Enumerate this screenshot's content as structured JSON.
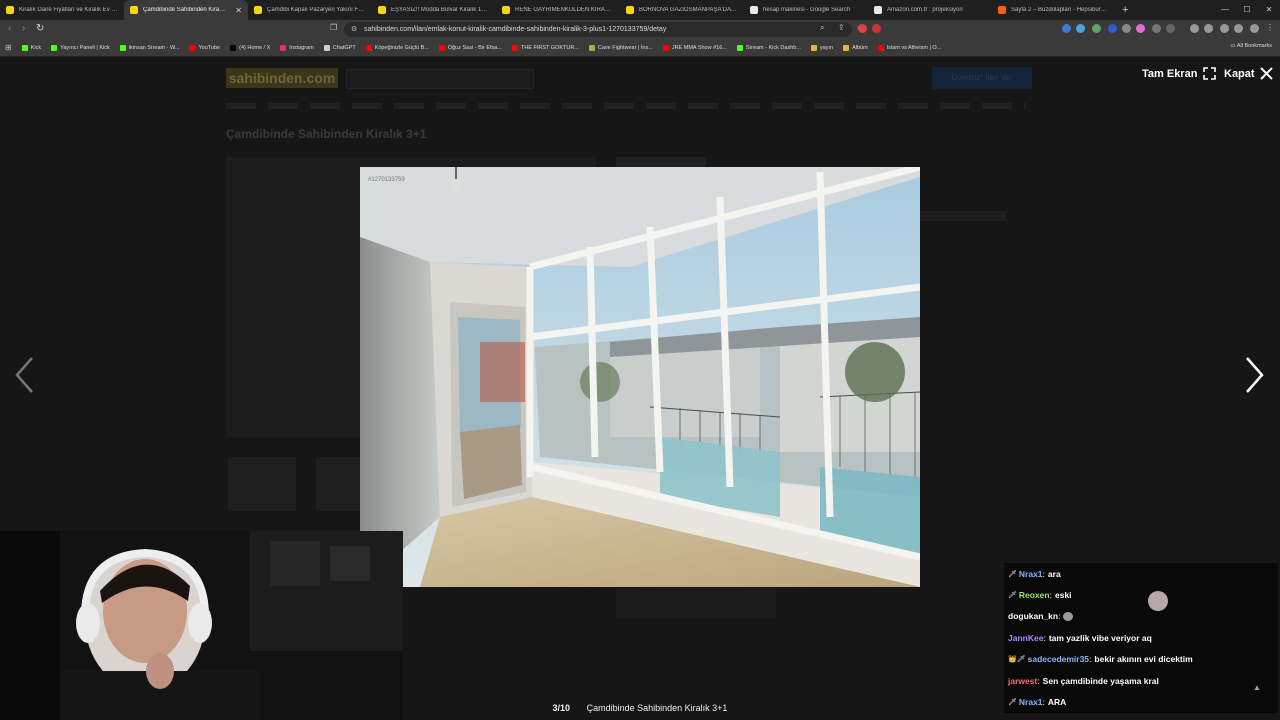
{
  "browser": {
    "tabs": [
      {
        "title": "Kiralık Daire Fiyatları ve Kiralık Ev İlanları",
        "color": "#f5d800",
        "icon": "sahibinden-favicon",
        "active": false
      },
      {
        "title": "Çamdibinde Sahibinden Kiralık 3+1",
        "color": "#f5d800",
        "icon": "sahibinden-favicon",
        "active": true
      },
      {
        "title": "Çamdibi Kapalı Pazaryeri Yakını Full E",
        "color": "#f5d800",
        "icon": "sahibinden-favicon",
        "active": false
      },
      {
        "title": "EŞYASIZ!! Modda Bulvar Kiralık 1+1 Da",
        "color": "#f5d800",
        "icon": "sahibinden-favicon",
        "active": false
      },
      {
        "title": "RENE GAYRİMENKULDEN KİRALIK 2+1",
        "color": "#f5d800",
        "icon": "sahibinden-favicon",
        "active": false
      },
      {
        "title": "BORNOVA GAZİOSMANPAŞA'DA KAPAL",
        "color": "#f5d800",
        "icon": "sahibinden-favicon",
        "active": false
      },
      {
        "title": "hesap makinesi - Google Search",
        "color": "#e8e8e8",
        "icon": "google-favicon",
        "active": false
      },
      {
        "title": "Amazon.com.tr : projeksiyon",
        "color": "#e8e8e8",
        "icon": "amazon-favicon",
        "active": false
      },
      {
        "title": "Sayfa 2 – Buzdolapları - Hepsiburada",
        "color": "#ff6000",
        "icon": "hepsiburada-favicon",
        "active": false
      }
    ],
    "tab_close": "✕",
    "new_tab": "+",
    "url": "sahibinden.com/ilan/emlak-konut-kiralik-camdibinde-sahibinden-kiralik-3-plus1-1270133759/detay",
    "bookmarks": [
      {
        "label": "Kick",
        "color": "#53fc18"
      },
      {
        "label": "Yayıncı Paneli | Kick",
        "color": "#53fc18"
      },
      {
        "label": "ikinsan Stream - W...",
        "color": "#53fc18"
      },
      {
        "label": "YouTube",
        "color": "#ff0000"
      },
      {
        "label": "(4) Home / X",
        "color": "#000000"
      },
      {
        "label": "Instagram",
        "color": "#e1306c"
      },
      {
        "label": "ChatGPT",
        "color": "#cccccc"
      },
      {
        "label": "Köpeğinizle Güçlü B...",
        "color": "#ff0000"
      },
      {
        "label": "Oğuz Sasi - Bir Efsa...",
        "color": "#ff0000"
      },
      {
        "label": "THE FIRST GOKTUR...",
        "color": "#ff0000"
      },
      {
        "label": "Cave Fightwear | İns...",
        "color": "#86c040"
      },
      {
        "label": "JRE MMA Show #16...",
        "color": "#ff0000"
      },
      {
        "label": "Stream - Kick Dashb...",
        "color": "#53fc18"
      },
      {
        "label": "yayın",
        "color": "#e0b040"
      },
      {
        "label": "Albüm",
        "color": "#e0b040"
      },
      {
        "label": "Islam vs Atheism | O...",
        "color": "#ff0000"
      }
    ],
    "all_bookmarks": "All Bookmarks"
  },
  "page": {
    "logo": "sahibinden.com",
    "cta": "Ücretsiz* İlan Ver",
    "title": "Çamdibinde Sahibinden Kiralık 3+1"
  },
  "viewer": {
    "fullscreen_label": "Tam Ekran",
    "close_label": "Kapat",
    "counter": "3/10",
    "caption": "Çamdibinde Sahibinden Kiralık 3+1",
    "photo_watermark": "#1270133759"
  },
  "chat": {
    "messages": [
      {
        "badge": "🗡",
        "user": "Nrax1",
        "color": "#8ab4f8",
        "msg": "ara"
      },
      {
        "badge": "🗡",
        "user": "Reoxen",
        "color": "#9be564",
        "msg": "eski"
      },
      {
        "badge": "",
        "user": "dogukan_kn",
        "color": "#ffffff",
        "msg": "",
        "emote": "emote"
      },
      {
        "badge": "",
        "user": "JannKee",
        "color": "#b388ff",
        "msg": "tam yazlik vibe veriyor aq"
      },
      {
        "badge": "👑🗡",
        "user": "sadecedemir35",
        "color": "#8ab4f8",
        "msg": "bekir akının evi dicektim"
      },
      {
        "badge": "",
        "user": "jarwest",
        "color": "#ff6b6b",
        "msg": "Sen çamdibinde yaşama kral"
      },
      {
        "badge": "🗡",
        "user": "Nrax1",
        "color": "#8ab4f8",
        "msg": "ARA"
      }
    ]
  }
}
